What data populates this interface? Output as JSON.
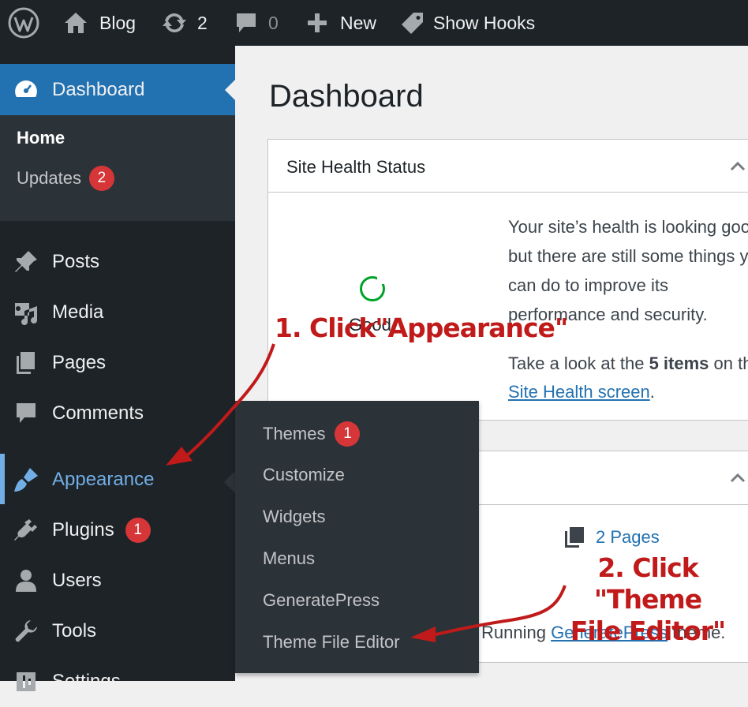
{
  "admin_bar": {
    "site_name": "Blog",
    "updates_count": "2",
    "comments_count": "0",
    "new_label": "New",
    "show_hooks_label": "Show Hooks"
  },
  "sidebar": {
    "dashboard": "Dashboard",
    "home": "Home",
    "updates": "Updates",
    "updates_badge": "2",
    "posts": "Posts",
    "media": "Media",
    "pages": "Pages",
    "comments": "Comments",
    "appearance": "Appearance",
    "plugins": "Plugins",
    "plugins_badge": "1",
    "users": "Users",
    "tools": "Tools",
    "settings": "Settings"
  },
  "flyout": {
    "themes": "Themes",
    "themes_badge": "1",
    "customize": "Customize",
    "widgets": "Widgets",
    "menus": "Menus",
    "generatepress": "GeneratePress",
    "theme_file_editor": "Theme File Editor"
  },
  "main": {
    "page_title": "Dashboard",
    "site_health": {
      "title": "Site Health Status",
      "status": "Good",
      "text": "Your site’s health is looking good, but there are still some things you can do to improve its performance and security.",
      "look_pre": "Take a look at the ",
      "look_bold": "5 items",
      "look_mid": " on the ",
      "look_link": "Site Health screen",
      "look_post": "."
    },
    "at_a_glance": {
      "pages": "2 Pages",
      "theme_pre": "Running ",
      "theme_link": "GeneratePress",
      "theme_post": " theme."
    }
  },
  "annotations": {
    "step1": "1. Click\"Appearance\"",
    "step2_line1": "2. Click \"Theme",
    "step2_line2": "File Editor\""
  },
  "colors": {
    "admin_dark": "#1d2327",
    "submenu_dark": "#2c3338",
    "active_blue": "#2271b1",
    "hover_blue": "#72aee6",
    "badge_red": "#d63638",
    "annotation_red": "#c01a1a"
  }
}
